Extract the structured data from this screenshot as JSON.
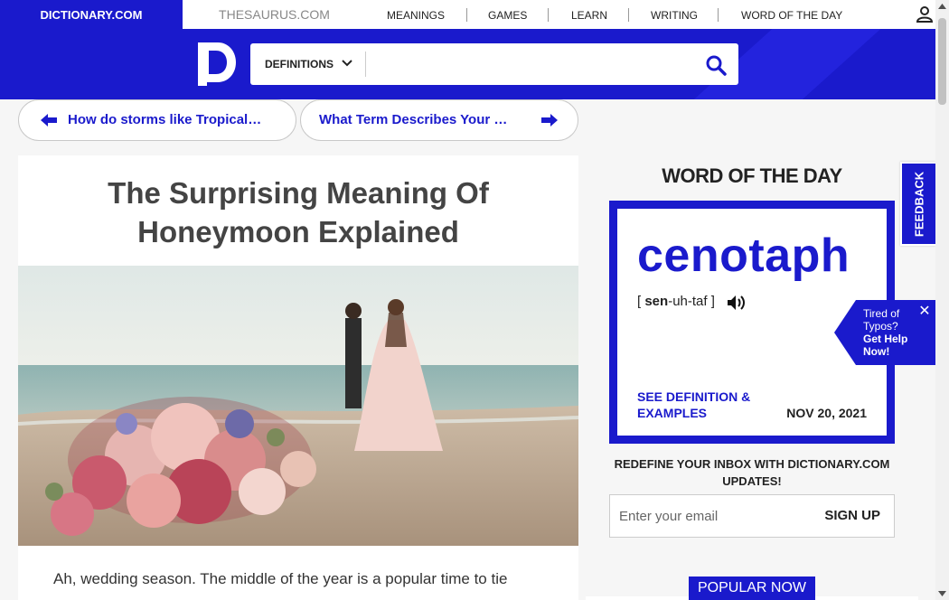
{
  "topbar": {
    "dictionary_tab": "DICTIONARY.COM",
    "thesaurus_tab": "THESAURUS.COM",
    "nav": [
      "MEANINGS",
      "GAMES",
      "LEARN",
      "WRITING",
      "WORD OF THE DAY"
    ]
  },
  "search": {
    "category": "DEFINITIONS",
    "placeholder": "",
    "value": ""
  },
  "pills": {
    "prev": "How do storms like Tropical…",
    "next": "What Term Describes Your …"
  },
  "article": {
    "title": "The Surprising Meaning Of Honeymoon Explained",
    "body": "Ah, wedding season. The middle of the year is a popular time to tie"
  },
  "wotd": {
    "heading": "WORD OF THE DAY",
    "word": "cenotaph",
    "pron_open": "[ ",
    "pron_stress": "sen",
    "pron_rest": "-uh-taf ]",
    "link": "SEE DEFINITION & EXAMPLES",
    "date": "NOV 20, 2021"
  },
  "newsletter": {
    "text": "REDEFINE YOUR INBOX WITH DICTIONARY.COM UPDATES!",
    "email_placeholder": "Enter your email",
    "button": "SIGN UP"
  },
  "popular": "POPULAR NOW",
  "feedback": "FEEDBACK",
  "typo": {
    "line1": "Tired of Typos?",
    "line2": "Get Help Now!"
  },
  "colors": {
    "brand_blue": "#1a1acc"
  }
}
